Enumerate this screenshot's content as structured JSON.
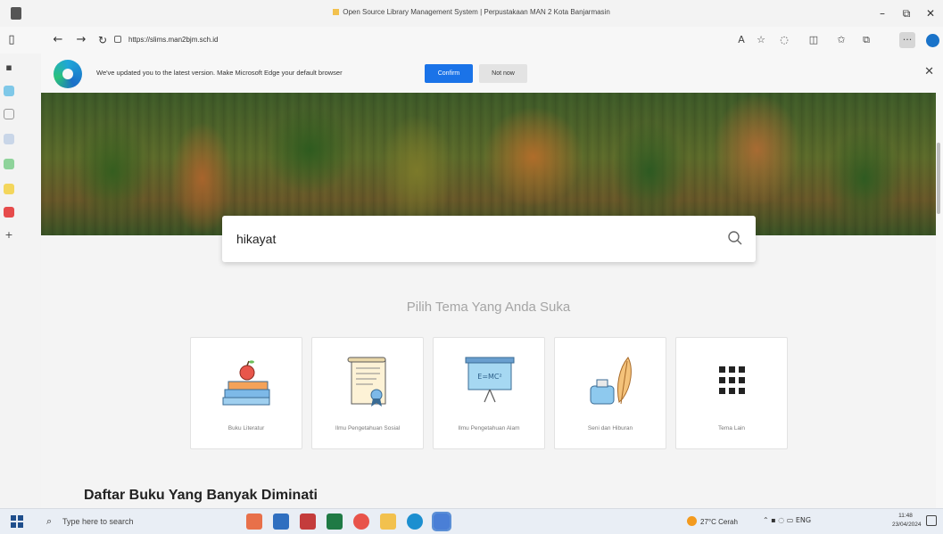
{
  "window": {
    "title": "Open Source Library Management System | Perpustakaan MAN 2 Kota Banjarmasin"
  },
  "addressbar": {
    "url": "https://slims.man2bjm.sch.id"
  },
  "notification": {
    "message": "We've updated you to the latest version. Make Microsoft Edge your default browser",
    "confirm_label": "Confirm",
    "not_now_label": "Not now"
  },
  "search": {
    "value": "hikayat"
  },
  "themes": {
    "title": "Pilih Tema Yang Anda Suka",
    "items": [
      {
        "label": "Buku Literatur",
        "icon": "books-apple-icon"
      },
      {
        "label": "Ilmu Pengetahuan Sosial",
        "icon": "scroll-certificate-icon"
      },
      {
        "label": "Ilmu Pengetahuan Alam",
        "icon": "whiteboard-formula-icon"
      },
      {
        "label": "Seni dan Hiburan",
        "icon": "ink-feather-icon"
      },
      {
        "label": "Tema Lain",
        "icon": "grid-dots-icon"
      }
    ]
  },
  "list": {
    "title": "Daftar Buku Yang Banyak Diminati"
  },
  "taskbar": {
    "search_placeholder": "Type here to search",
    "weather": "27°C Cerah",
    "language": "ENG",
    "time": "11:48",
    "date": "23/04/2024"
  },
  "colors": {
    "accent": "#1a73e8",
    "page_bg": "#f4f4f4"
  }
}
